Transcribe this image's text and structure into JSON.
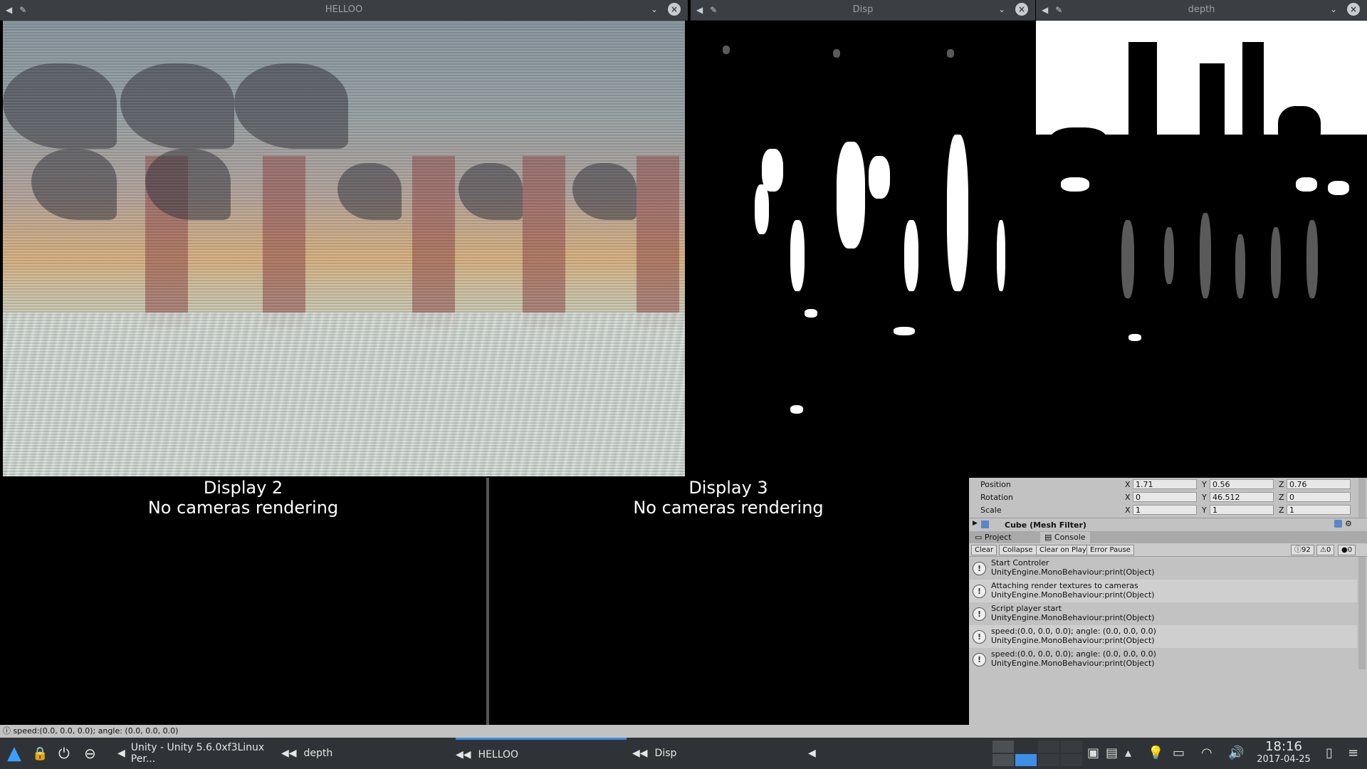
{
  "windows": {
    "helloo": {
      "title": "HELLOO"
    },
    "disp": {
      "title": "Disp"
    },
    "depth": {
      "title": "depth"
    }
  },
  "displays": {
    "display2": {
      "title": "Display 2",
      "message": "No cameras rendering"
    },
    "display3": {
      "title": "Display 3",
      "message": "No cameras rendering"
    }
  },
  "transform": {
    "position": {
      "label": "Position",
      "x": "1.71",
      "y": "0.56",
      "z": "0.76"
    },
    "rotation": {
      "label": "Rotation",
      "x": "0",
      "y": "46.512",
      "z": "0"
    },
    "scale": {
      "label": "Scale",
      "x": "1",
      "y": "1",
      "z": "1"
    },
    "axis_x": "X",
    "axis_y": "Y",
    "axis_z": "Z"
  },
  "component": {
    "label": "Cube (Mesh Filter)"
  },
  "tabs": {
    "project": "Project",
    "console": "Console"
  },
  "console": {
    "clear": "Clear",
    "collapse": "Collapse",
    "clear_on_play": "Clear on Play",
    "error_pause": "Error Pause",
    "count_log": "92",
    "count_warn": "0",
    "count_error": "0",
    "logs": [
      {
        "line1": "Start Controler",
        "line2": "UnityEngine.MonoBehaviour:print(Object)"
      },
      {
        "line1": "Attaching render textures to cameras",
        "line2": "UnityEngine.MonoBehaviour:print(Object)"
      },
      {
        "line1": "Script player start",
        "line2": "UnityEngine.MonoBehaviour:print(Object)"
      },
      {
        "line1": "speed:(0.0, 0.0, 0.0); angle: (0.0, 0.0, 0.0)",
        "line2": "UnityEngine.MonoBehaviour:print(Object)"
      },
      {
        "line1": "speed:(0.0, 0.0, 0.0); angle: (0.0, 0.0, 0.0)",
        "line2": "UnityEngine.MonoBehaviour:print(Object)"
      }
    ]
  },
  "status_bar": {
    "text": "speed:(0.0, 0.0, 0.0); angle: (0.0, 0.0, 0.0)"
  },
  "taskbar": {
    "tasks": [
      {
        "label": "Unity - Unity 5.6.0xf3Linux Per..."
      },
      {
        "label": "depth"
      },
      {
        "label": "HELLOO"
      },
      {
        "label": "Disp"
      }
    ],
    "clock_time": "18:16",
    "clock_date": "2017-04-25"
  }
}
